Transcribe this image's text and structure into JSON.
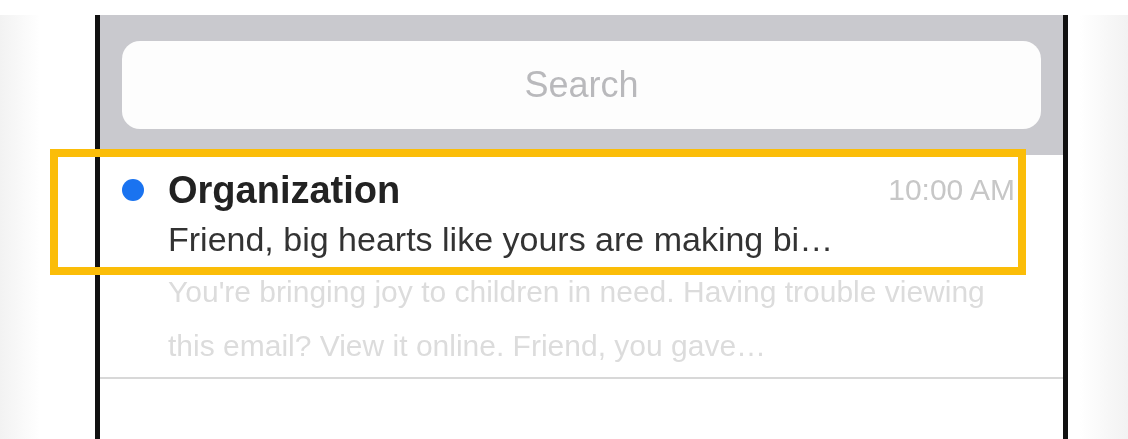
{
  "search": {
    "placeholder": "Search"
  },
  "messages": [
    {
      "sender": "Organization",
      "time": "10:00 AM",
      "unread": true,
      "highlighted": true,
      "subject": "Friend, big hearts like yours are making bi…",
      "preview": "You're bringing joy to children in need. Having trouble viewing this email? View it online. Friend, you gave…"
    }
  ]
}
